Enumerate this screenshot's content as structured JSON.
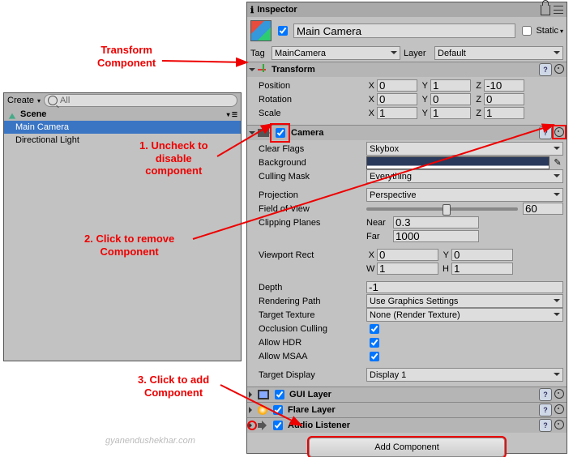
{
  "watermark": "gyanendushekhar.com",
  "hierarchy": {
    "create_label": "Create",
    "search_placeholder": "All",
    "scene_label": "Scene",
    "items": [
      "Main Camera",
      "Directional Light"
    ]
  },
  "inspector": {
    "title": "Inspector",
    "object_name": "Main Camera",
    "static_label": "Static",
    "tag_label": "Tag",
    "tag_value": "MainCamera",
    "layer_label": "Layer",
    "layer_value": "Default"
  },
  "transform": {
    "title": "Transform",
    "position": {
      "label": "Position",
      "x": "0",
      "y": "1",
      "z": "-10"
    },
    "rotation": {
      "label": "Rotation",
      "x": "0",
      "y": "0",
      "z": "0"
    },
    "scale": {
      "label": "Scale",
      "x": "1",
      "y": "1",
      "z": "1"
    }
  },
  "camera": {
    "title": "Camera",
    "clear_flags": {
      "label": "Clear Flags",
      "value": "Skybox"
    },
    "background": {
      "label": "Background"
    },
    "culling_mask": {
      "label": "Culling Mask",
      "value": "Everything"
    },
    "projection": {
      "label": "Projection",
      "value": "Perspective"
    },
    "fov": {
      "label": "Field of View",
      "value": "60"
    },
    "clipping": {
      "label": "Clipping Planes",
      "near_label": "Near",
      "near": "0.3",
      "far_label": "Far",
      "far": "1000"
    },
    "viewport": {
      "label": "Viewport Rect",
      "x": "0",
      "y": "0",
      "w": "1",
      "h": "1"
    },
    "depth": {
      "label": "Depth",
      "value": "-1"
    },
    "rendering_path": {
      "label": "Rendering Path",
      "value": "Use Graphics Settings"
    },
    "target_texture": {
      "label": "Target Texture",
      "value": "None (Render Texture)"
    },
    "occlusion": {
      "label": "Occlusion Culling"
    },
    "allow_hdr": {
      "label": "Allow HDR"
    },
    "allow_msaa": {
      "label": "Allow MSAA"
    },
    "target_display": {
      "label": "Target Display",
      "value": "Display 1"
    }
  },
  "extra_components": {
    "gui_layer": "GUI Layer",
    "flare_layer": "Flare Layer",
    "audio_listener": "Audio Listener"
  },
  "add_component_label": "Add Component",
  "annotations": {
    "transform": "Transform\nComponent",
    "uncheck": "1. Uncheck to\ndisable\ncomponent",
    "remove": "2. Click to remove\nComponent",
    "add": "3. Click to add\nComponent"
  },
  "axis": {
    "x": "X",
    "y": "Y",
    "z": "Z",
    "w": "W",
    "h": "H"
  }
}
